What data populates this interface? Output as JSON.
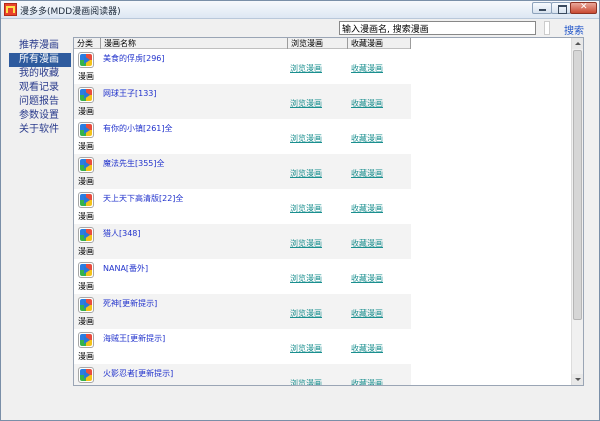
{
  "window": {
    "title": "漫多多(MDD漫画阅读器)"
  },
  "search": {
    "placeholder": "输入漫画名, 搜索漫画",
    "value": "输入漫画名, 搜索漫画",
    "button_label": "搜索"
  },
  "sidebar": {
    "items": [
      {
        "label": "推荐漫画"
      },
      {
        "label": "所有漫画",
        "active": true
      },
      {
        "label": "我的收藏"
      },
      {
        "label": "观看记录"
      },
      {
        "label": "问题报告"
      },
      {
        "label": "参数设置"
      },
      {
        "label": "关于软件"
      }
    ]
  },
  "table": {
    "headers": [
      "分类",
      "漫画名称",
      "浏览漫画",
      "收藏漫画"
    ],
    "category_label": "漫画",
    "browse_label": "浏览漫画",
    "favorite_label": "收藏漫画",
    "rows": [
      {
        "name": "美食的俘虏[296]"
      },
      {
        "name": "网球王子[133]"
      },
      {
        "name": "有你的小镇[261]全"
      },
      {
        "name": "魔法先生[355]全"
      },
      {
        "name": "天上天下高清版[22]全"
      },
      {
        "name": "猎人[348]"
      },
      {
        "name": "NANA[番外]"
      },
      {
        "name": "死神[更新提示]"
      },
      {
        "name": "海贼王[更新提示]"
      },
      {
        "name": "火影忍者[更新提示]"
      }
    ]
  },
  "icons": {
    "app": "app-logo-icon",
    "cover": "manga-cover-icon"
  }
}
